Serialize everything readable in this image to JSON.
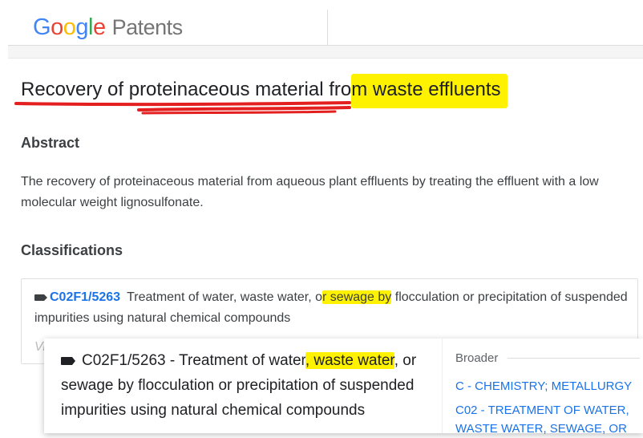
{
  "header": {
    "logo_letters": [
      "G",
      "o",
      "o",
      "g",
      "l",
      "e"
    ],
    "product": "Patents"
  },
  "patent": {
    "title_part1": "Recovery of proteinaceous material fro",
    "title_part2": "m waste effluents",
    "abstract_heading": "Abstract",
    "abstract_text": "The recovery of proteinaceous material from aqueous plant effluents by treating the effluent with a low molecular weight lignosulfonate.",
    "classifications_heading": "Classifications",
    "classification": {
      "code": "C02F1/5263",
      "desc_part1": "Treatment of water, waste water, o",
      "desc_hl": "r sewage by",
      "desc_part2": " flocculation or precipitation of suspended impurities using natural chemical compounds"
    },
    "view_more": "Vi"
  },
  "popup": {
    "desc_part1": "C02F1/5263 - Treatment of water",
    "desc_hl": ", waste water",
    "desc_part2": ", or sewage by flocculation or precipitation of suspended impurities using natural chemical compounds",
    "broader_label": "Broader",
    "broader_links": [
      "C - CHEMISTRY; METALLURGY",
      "C02 - TREATMENT OF WATER, WASTE WATER, SEWAGE, OR"
    ]
  },
  "colors": {
    "highlight": "#fff200",
    "link": "#1a73e8",
    "annotation_red": "#e41f1f"
  }
}
